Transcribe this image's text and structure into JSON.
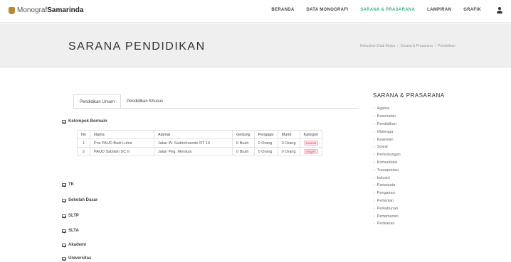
{
  "brand": {
    "light": "Monograf",
    "bold": "Samarinda"
  },
  "nav": [
    {
      "label": "BERANDA",
      "active": false
    },
    {
      "label": "DATA MONOGRAFI",
      "active": false
    },
    {
      "label": "SARANA & PRASARANA",
      "active": true
    },
    {
      "label": "LAMPIRAN",
      "active": false
    },
    {
      "label": "GRAFIK",
      "active": false
    }
  ],
  "page_title": "SARANA PENDIDIKAN",
  "breadcrumb": [
    "Kelurahan Dadi Mulya",
    "Sarana & Prasarana",
    "Pendidikan"
  ],
  "tabs": [
    {
      "label": "Pendidikan Umum",
      "active": true
    },
    {
      "label": "Pendidikan Khusus",
      "active": false
    }
  ],
  "sections": [
    "Kelompok Bermain",
    "TK",
    "Sekolah Dasar",
    "SLTP",
    "SLTA",
    "Akademi",
    "Universitas"
  ],
  "table": {
    "headers": [
      "No",
      "Nama",
      "Alamat",
      "Gedung",
      "Pengajar",
      "Murid",
      "Kategori"
    ],
    "rows": [
      [
        "1",
        "Pos PAUD Budi Luhur",
        "Jalan W. Sudirohusodo RT 10",
        "0 Buah",
        "0 Orang",
        "0 Orang",
        "Swasta"
      ],
      [
        "2",
        "PAUD Sabillah SC II",
        "Jalan Peg. Meratus",
        "0 Buah",
        "0 Orang",
        "0 Orang",
        "Negeri"
      ]
    ]
  },
  "sidebar": {
    "title": "SARANA & PRASARANA",
    "items": [
      "Agama",
      "Kesehatan",
      "Pendidikan",
      "Olahraga",
      "Kesenian",
      "Sosial",
      "Perhubungan",
      "Komunikasi",
      "Transportasi",
      "Industri",
      "Pariwisata",
      "Pengairan",
      "Pertanian",
      "Perkebunan",
      "Pertamanan",
      "Perikanan"
    ]
  },
  "colors": {
    "accent": "#3fb08a",
    "badge": "#e0435a",
    "header_band": "#efefef"
  }
}
